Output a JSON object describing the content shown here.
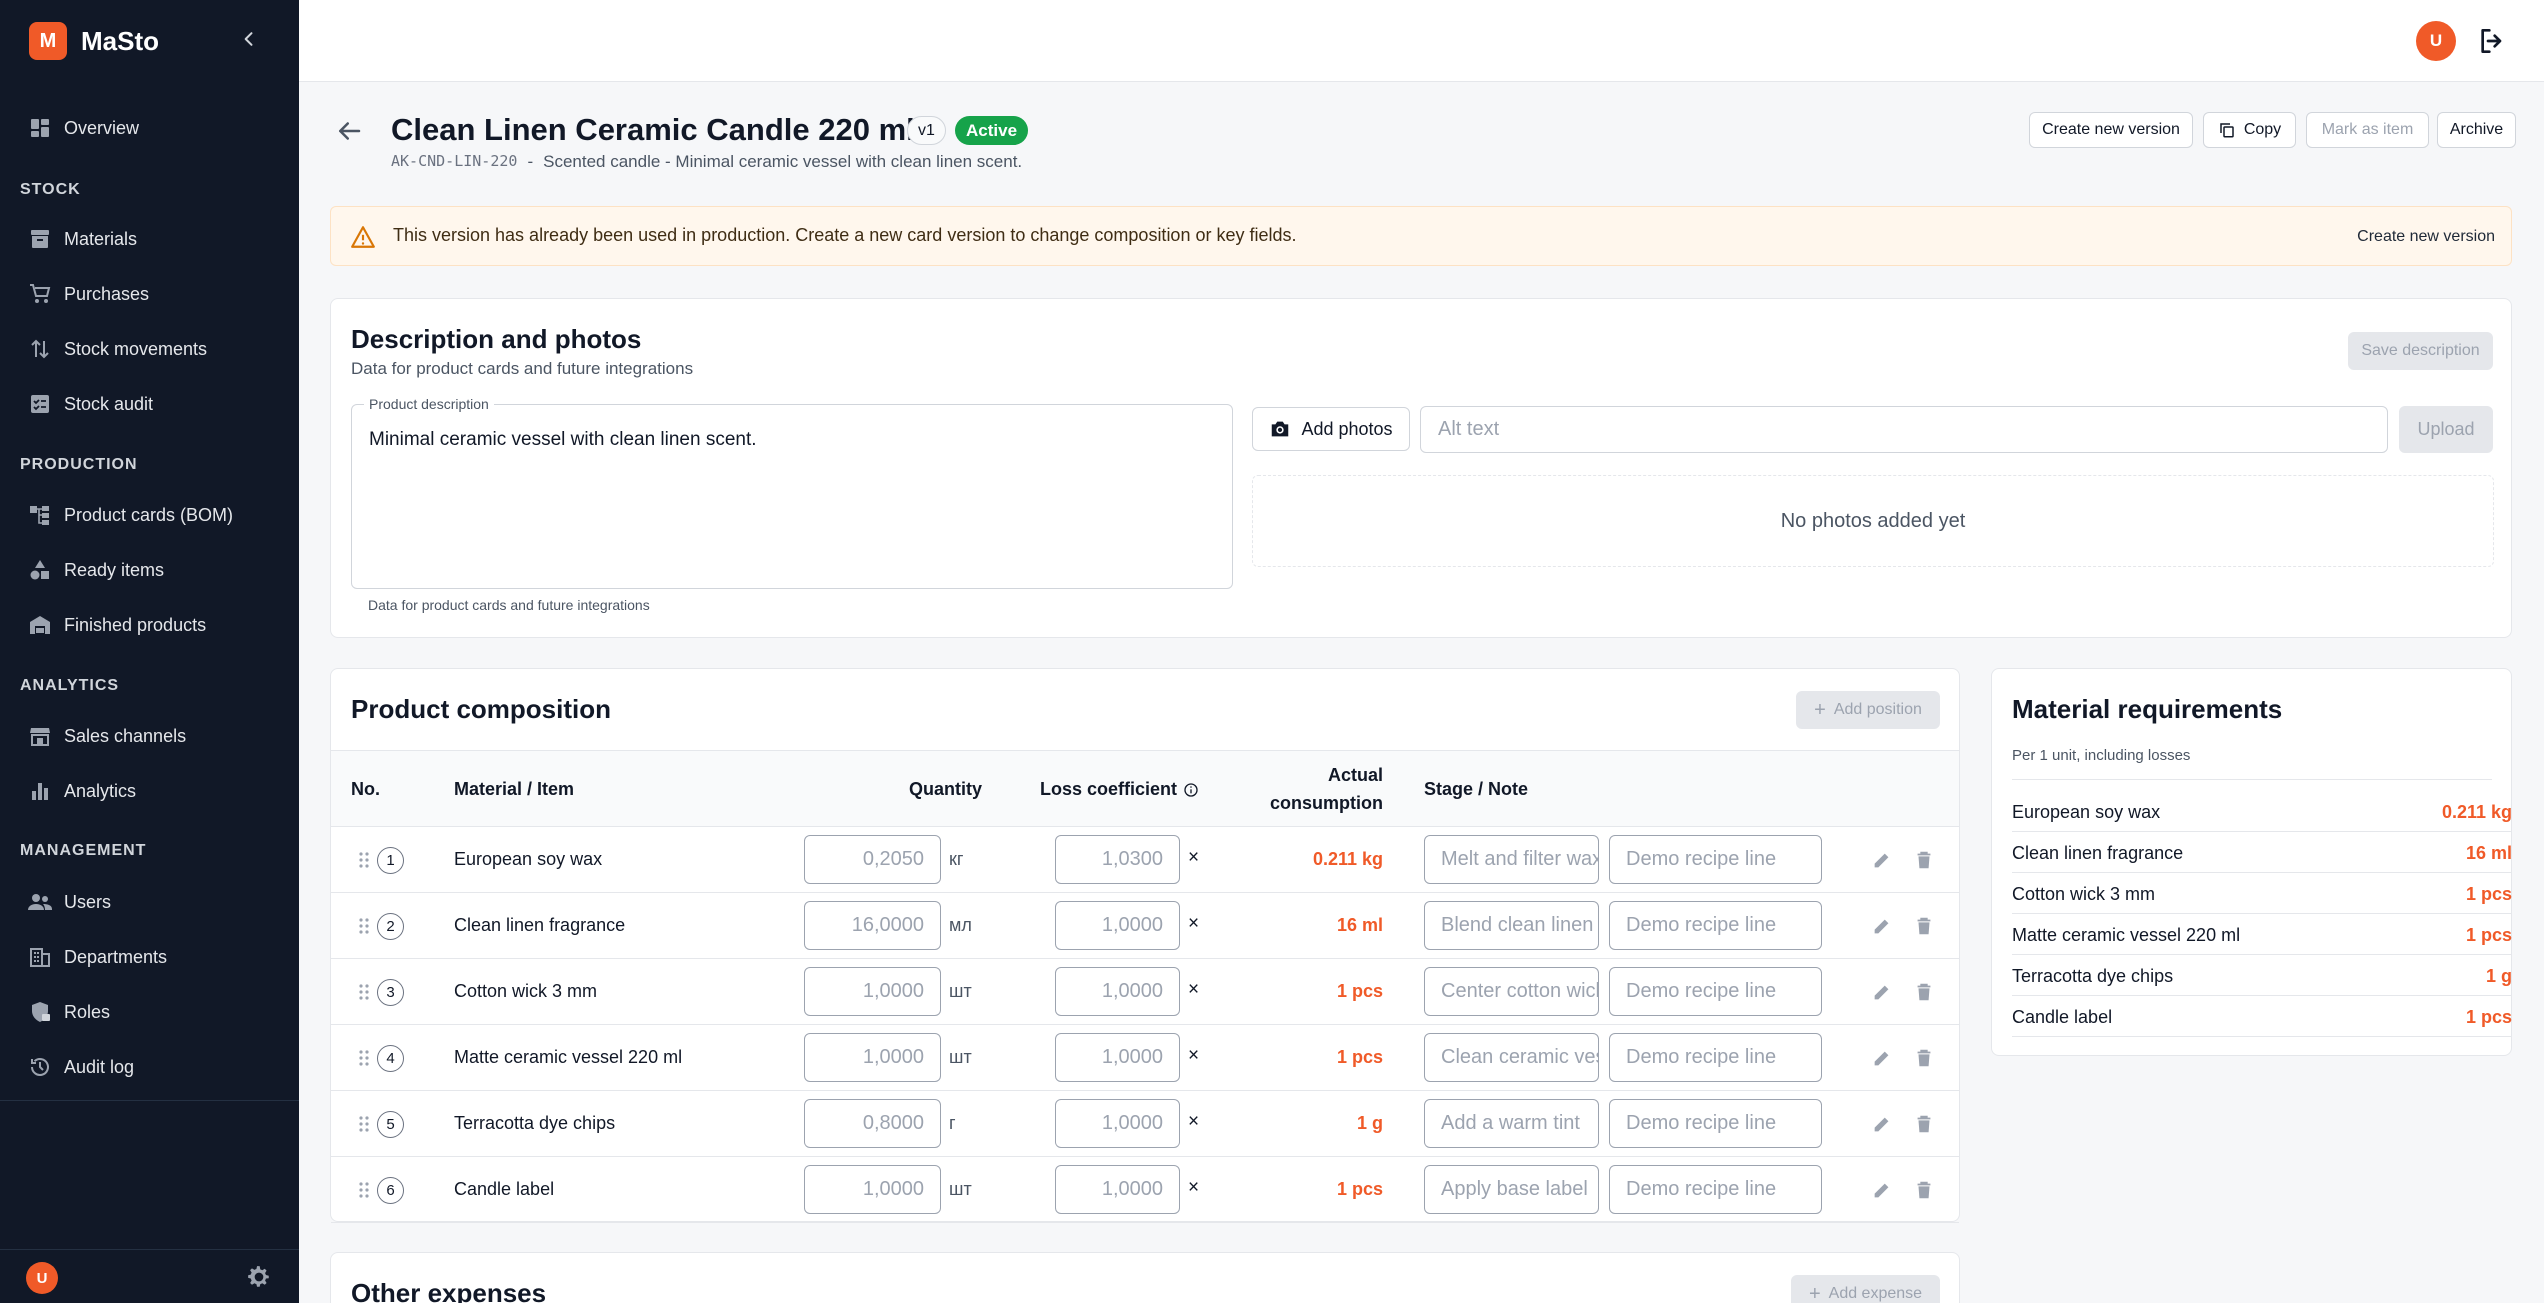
{
  "app": {
    "brand_letter": "M",
    "brand_name": "MaSto",
    "user_initial": "U"
  },
  "sidebar": {
    "top_items": [
      {
        "label": "Overview",
        "icon": "dashboard-icon"
      }
    ],
    "sections": [
      {
        "title": "STOCK",
        "items": [
          {
            "label": "Materials",
            "icon": "archive-icon"
          },
          {
            "label": "Purchases",
            "icon": "cart-icon"
          },
          {
            "label": "Stock movements",
            "icon": "swap-vertical-icon"
          },
          {
            "label": "Stock audit",
            "icon": "checklist-icon"
          }
        ]
      },
      {
        "title": "PRODUCTION",
        "items": [
          {
            "label": "Product cards (BOM)",
            "icon": "hierarchy-icon"
          },
          {
            "label": "Ready items",
            "icon": "shapes-icon"
          },
          {
            "label": "Finished products",
            "icon": "warehouse-icon"
          }
        ]
      },
      {
        "title": "ANALYTICS",
        "items": [
          {
            "label": "Sales channels",
            "icon": "storefront-icon"
          },
          {
            "label": "Analytics",
            "icon": "bar-chart-icon"
          }
        ]
      },
      {
        "title": "MANAGEMENT",
        "items": [
          {
            "label": "Users",
            "icon": "users-icon"
          },
          {
            "label": "Departments",
            "icon": "building-icon"
          },
          {
            "label": "Roles",
            "icon": "shield-lock-icon"
          },
          {
            "label": "Audit log",
            "icon": "history-icon"
          }
        ]
      }
    ]
  },
  "header": {
    "title": "Clean Linen Ceramic Candle 220 ml",
    "version": "v1",
    "status": "Active",
    "sku": "AK-CND-LIN-220",
    "separator": "-",
    "subtitle": "Scented candle - Minimal ceramic vessel with clean linen scent.",
    "buttons": {
      "new_version": "Create new version",
      "copy": "Copy",
      "mark_as_item": "Mark as item",
      "archive": "Archive"
    }
  },
  "warning": {
    "text": "This version has already been used in production. Create a new card version to change composition or key fields.",
    "action": "Create new version"
  },
  "description_card": {
    "title": "Description and photos",
    "subtitle": "Data for product cards and future integrations",
    "save_label": "Save description",
    "field_label": "Product description",
    "field_value": "Minimal ceramic vessel with clean linen scent.",
    "field_help": "Data for product cards and future integrations",
    "add_photos_label": "Add photos",
    "alt_placeholder": "Alt text",
    "upload_label": "Upload",
    "empty_photos": "No photos added yet"
  },
  "composition": {
    "title": "Product composition",
    "add_label": "Add position",
    "columns": {
      "no": "No.",
      "material": "Material / Item",
      "quantity": "Quantity",
      "loss": "Loss coefficient",
      "actual_1": "Actual",
      "actual_2": "consumption",
      "stage": "Stage / Note"
    },
    "multiply_sign": "×",
    "rows": [
      {
        "no": "1",
        "name": "European soy wax",
        "qty": "0,2050",
        "unit": "кг",
        "loss": "1,0300",
        "actual": "0.211 kg",
        "stage": "Melt and filter wax",
        "note": "Demo recipe line"
      },
      {
        "no": "2",
        "name": "Clean linen fragrance",
        "qty": "16,0000",
        "unit": "мл",
        "loss": "1,0000",
        "actual": "16 ml",
        "stage": "Blend clean linen",
        "note": "Demo recipe line"
      },
      {
        "no": "3",
        "name": "Cotton wick 3 mm",
        "qty": "1,0000",
        "unit": "шт",
        "loss": "1,0000",
        "actual": "1 pcs",
        "stage": "Center cotton wick",
        "note": "Demo recipe line"
      },
      {
        "no": "4",
        "name": "Matte ceramic vessel 220 ml",
        "qty": "1,0000",
        "unit": "шт",
        "loss": "1,0000",
        "actual": "1 pcs",
        "stage": "Clean ceramic vessel",
        "note": "Demo recipe line"
      },
      {
        "no": "5",
        "name": "Terracotta dye chips",
        "qty": "0,8000",
        "unit": "г",
        "loss": "1,0000",
        "actual": "1 g",
        "stage": "Add a warm tint",
        "note": "Demo recipe line"
      },
      {
        "no": "6",
        "name": "Candle label",
        "qty": "1,0000",
        "unit": "шт",
        "loss": "1,0000",
        "actual": "1 pcs",
        "stage": "Apply base label",
        "note": "Demo recipe line"
      }
    ]
  },
  "requirements": {
    "title": "Material requirements",
    "subtitle": "Per 1 unit, including losses",
    "items": [
      {
        "name": "European soy wax",
        "value": "0.211 kg"
      },
      {
        "name": "Clean linen fragrance",
        "value": "16 ml"
      },
      {
        "name": "Cotton wick 3 mm",
        "value": "1 pcs"
      },
      {
        "name": "Matte ceramic vessel 220 ml",
        "value": "1 pcs"
      },
      {
        "name": "Terracotta dye chips",
        "value": "1 g"
      },
      {
        "name": "Candle label",
        "value": "1 pcs"
      }
    ]
  },
  "other_expenses": {
    "title": "Other expenses",
    "add_label": "Add expense"
  },
  "colors": {
    "accent": "#f05a28",
    "sidebar_bg": "#111827",
    "success": "#16a34a"
  }
}
